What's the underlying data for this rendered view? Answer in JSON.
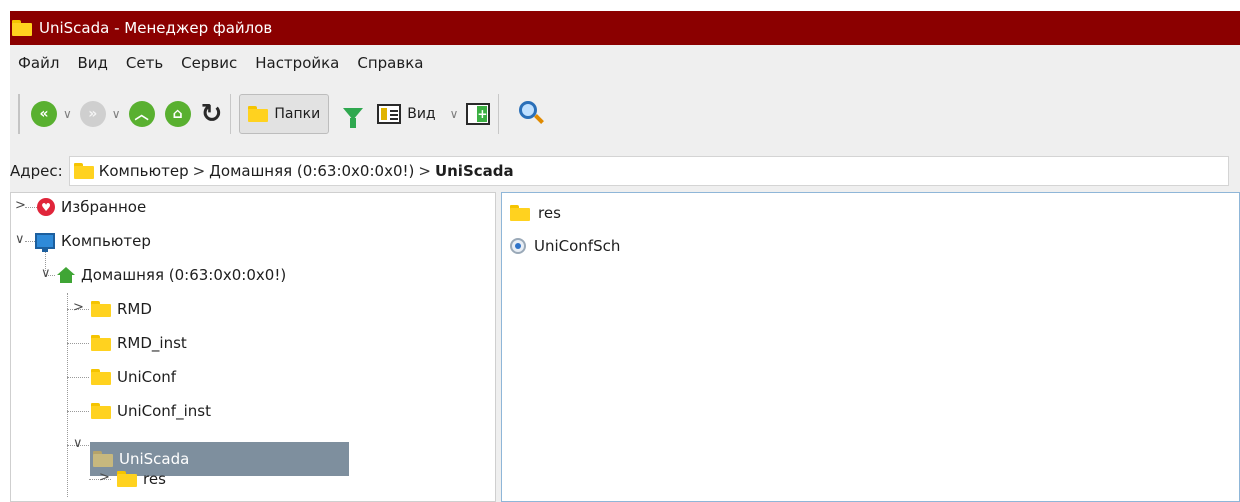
{
  "window": {
    "title": "UniScada - Менеджер файлов",
    "icon": "folder-icon"
  },
  "menu": [
    "Файл",
    "Вид",
    "Сеть",
    "Сервис",
    "Настройка",
    "Справка"
  ],
  "toolbar": {
    "folders_label": "Папки",
    "view_label": "Вид",
    "icons": [
      "back-icon",
      "forward-icon",
      "up-icon",
      "home-icon",
      "refresh-icon",
      "folders-icon",
      "filter-icon",
      "view-icon",
      "panel-icon",
      "search-icon"
    ]
  },
  "address": {
    "label": "Адрес:",
    "crumbs": [
      "Компьютер",
      "Домашняя (0:63:0x0:0x0!)",
      "UniScada"
    ]
  },
  "tree": {
    "items": [
      {
        "label": "Избранное",
        "icon": "heart-icon",
        "expander": ">"
      },
      {
        "label": "Компьютер",
        "icon": "computer-icon",
        "expander": "v"
      },
      {
        "label": "Домашняя (0:63:0x0:0x0!)",
        "icon": "home-icon",
        "expander": "v"
      },
      {
        "label": "RMD",
        "icon": "folder-icon",
        "expander": ">"
      },
      {
        "label": "RMD_inst",
        "icon": "folder-icon"
      },
      {
        "label": "UniConf",
        "icon": "folder-icon"
      },
      {
        "label": "UniConf_inst",
        "icon": "folder-icon"
      },
      {
        "label": "UniScada",
        "icon": "folder-icon",
        "expander": "v",
        "selected": true
      },
      {
        "label": "res",
        "icon": "folder-icon",
        "expander": ">"
      }
    ]
  },
  "content": {
    "items": [
      {
        "label": "res",
        "icon": "folder-icon"
      },
      {
        "label": "UniConfSch",
        "icon": "file-icon"
      }
    ]
  },
  "colors": {
    "titlebar": "#8b0000",
    "selection": "#7e8f9e",
    "accent_green": "#59b030"
  }
}
